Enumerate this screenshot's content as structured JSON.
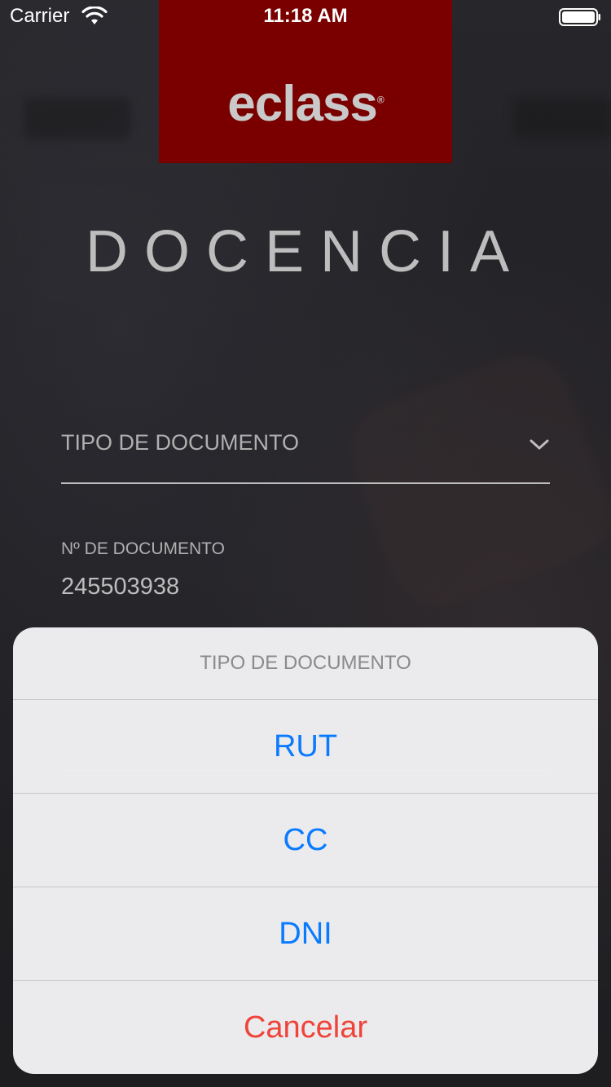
{
  "status_bar": {
    "carrier": "Carrier",
    "time": "11:18 AM",
    "wifi_icon": "wifi-icon",
    "battery_icon": "battery-icon"
  },
  "brand": {
    "logo_text": "eclass",
    "logo_mark": "®",
    "logo_bg_color": "#7a0000"
  },
  "page": {
    "title": "DOCENCIA"
  },
  "form": {
    "doc_type": {
      "label": "TIPO DE DOCUMENTO",
      "icon": "chevron-down-icon"
    },
    "doc_number": {
      "label": "Nº DE DOCUMENTO",
      "value": "245503938"
    }
  },
  "action_sheet": {
    "title": "TIPO DE DOCUMENTO",
    "options": [
      "RUT",
      "CC",
      "DNI"
    ],
    "cancel_label": "Cancelar",
    "option_color": "#0a7aff",
    "cancel_color": "#f0433a"
  }
}
